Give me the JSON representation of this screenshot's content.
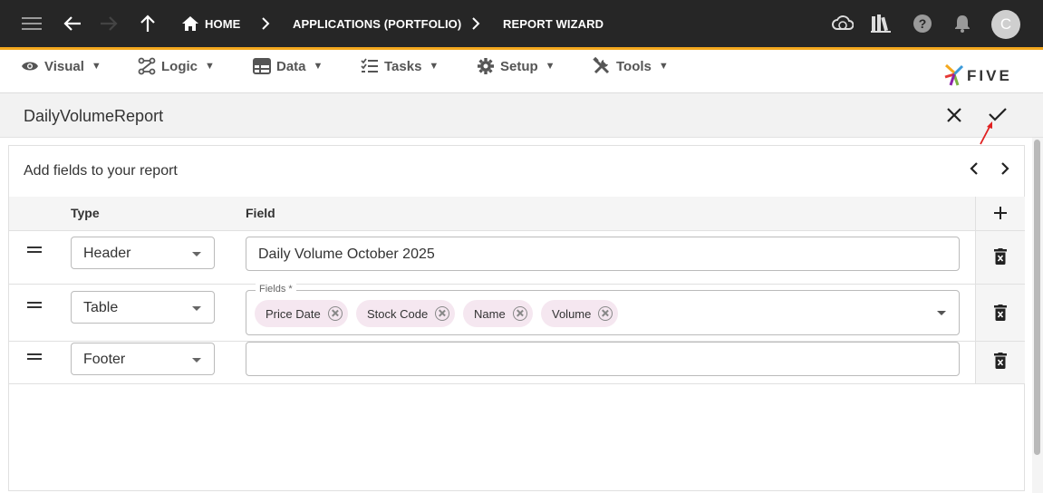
{
  "topbar": {
    "breadcrumbs": [
      "HOME",
      "APPLICATIONS (PORTFOLIO)",
      "REPORT WIZARD"
    ],
    "avatar_initial": "C",
    "accent_color": "#f4a81d",
    "icons": [
      "menu-icon",
      "back-arrow-icon",
      "forward-arrow-icon",
      "up-arrow-icon",
      "home-icon",
      "cloud-sync-icon",
      "library-icon",
      "help-icon",
      "bell-icon"
    ]
  },
  "menubar": {
    "items": [
      {
        "label": "Visual",
        "icon": "eye-icon"
      },
      {
        "label": "Logic",
        "icon": "logic-icon"
      },
      {
        "label": "Data",
        "icon": "table-icon"
      },
      {
        "label": "Tasks",
        "icon": "tasks-icon"
      },
      {
        "label": "Setup",
        "icon": "gear-icon"
      },
      {
        "label": "Tools",
        "icon": "tools-icon"
      }
    ],
    "caret": "▼",
    "logo_text": "FIVE"
  },
  "page": {
    "title": "DailyVolumeReport"
  },
  "card": {
    "title": "Add fields to your report",
    "columns": {
      "type": "Type",
      "field": "Field"
    },
    "rows": [
      {
        "type": "Header",
        "field_value": "Daily Volume October 2025"
      },
      {
        "type": "Table",
        "fields_label": "Fields *",
        "chips": [
          "Price Date",
          "Stock Code",
          "Name",
          "Volume"
        ]
      },
      {
        "type": "Footer",
        "field_value": ""
      }
    ]
  }
}
